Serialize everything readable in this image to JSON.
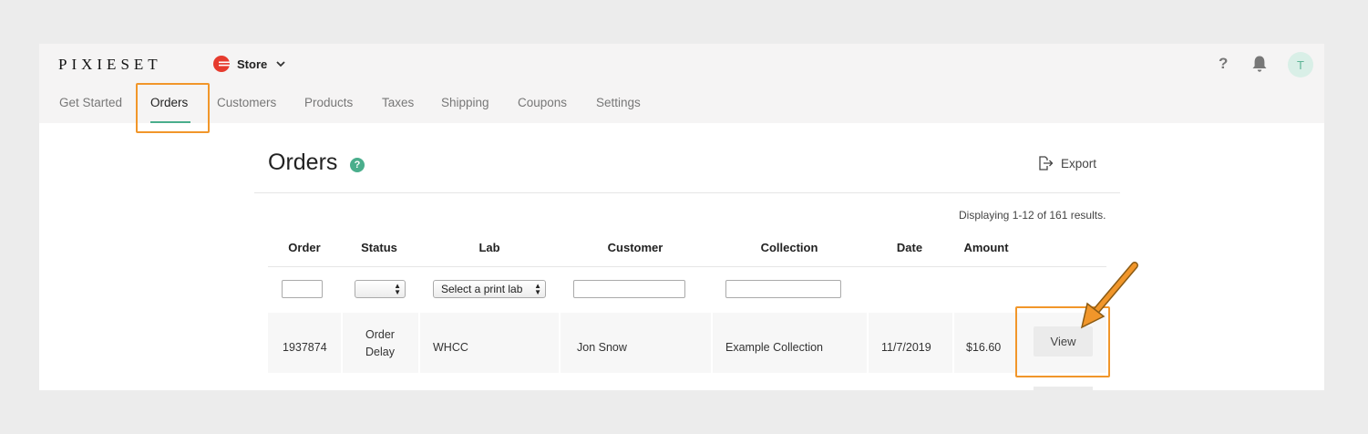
{
  "brand": {
    "logo": "PIXIESET"
  },
  "store_menu": {
    "label": "Store",
    "icon": "store-logo-icon",
    "chevron": "chevron-down-icon"
  },
  "header_icons": {
    "help": "?",
    "notifications": "bell-icon",
    "avatar_initial": "T"
  },
  "nav": {
    "items": [
      {
        "label": "Get Started"
      },
      {
        "label": "Orders"
      },
      {
        "label": "Customers"
      },
      {
        "label": "Products"
      },
      {
        "label": "Taxes"
      },
      {
        "label": "Shipping"
      },
      {
        "label": "Coupons"
      },
      {
        "label": "Settings"
      }
    ],
    "active": "Orders"
  },
  "page": {
    "title": "Orders",
    "help_badge": "?",
    "export_label": "Export",
    "results_text": "Displaying 1-12 of 161 results."
  },
  "table": {
    "columns": [
      "Order",
      "Status",
      "Lab",
      "Customer",
      "Collection",
      "Date",
      "Amount"
    ],
    "filters": {
      "lab_placeholder": "Select a print lab"
    },
    "rows": [
      {
        "order": "1937874",
        "status_line1": "Order",
        "status_line2": "Delay",
        "lab": "WHCC",
        "customer": "Jon Snow",
        "collection": "Example Collection",
        "date": "11/7/2019",
        "amount": "$16.60",
        "action": "View"
      }
    ]
  },
  "colors": {
    "accent": "#4aae8c",
    "highlight": "#f1962a",
    "brand_red": "#e63b2e"
  }
}
